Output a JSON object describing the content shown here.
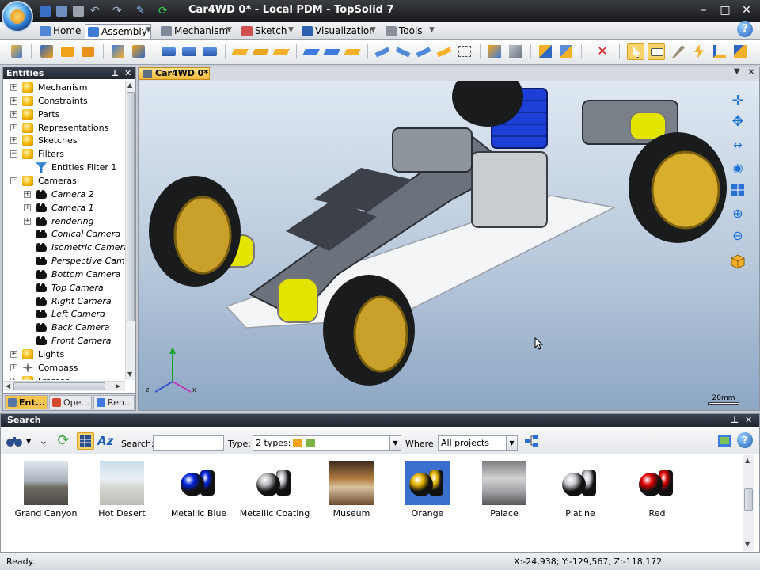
{
  "window": {
    "title": "Car4WD 0* - Local PDM - TopSolid 7",
    "minimize": "–",
    "maximize": "□",
    "close": "✕"
  },
  "ribbon": {
    "tabs": [
      {
        "label": "Home",
        "icon": "home-icon",
        "active": false
      },
      {
        "label": "Assembly",
        "icon": "assembly-icon",
        "active": true
      },
      {
        "label": "Mechanism",
        "icon": "mechanism-icon",
        "active": false
      },
      {
        "label": "Sketch",
        "icon": "sketch-icon",
        "active": false
      },
      {
        "label": "Visualization",
        "icon": "visualization-icon",
        "active": false
      },
      {
        "label": "Tools",
        "icon": "tools-icon",
        "active": false
      }
    ],
    "help": "?"
  },
  "entities": {
    "header": "Entities",
    "pin": "⊥",
    "close": "✕",
    "tree": [
      {
        "label": "Mechanism",
        "level": 0,
        "expander": "+",
        "icon": "cube-icon",
        "italic": false
      },
      {
        "label": "Constraints",
        "level": 0,
        "expander": "+",
        "icon": "cube-icon",
        "italic": false
      },
      {
        "label": "Parts",
        "level": 0,
        "expander": "+",
        "icon": "cube-icon",
        "italic": false
      },
      {
        "label": "Representations",
        "level": 0,
        "expander": "+",
        "icon": "cube-icon",
        "italic": false
      },
      {
        "label": "Sketches",
        "level": 0,
        "expander": "+",
        "icon": "cube-icon",
        "italic": false
      },
      {
        "label": "Filters",
        "level": 0,
        "expander": "−",
        "icon": "cube-icon",
        "italic": false
      },
      {
        "label": "Entities Filter 1",
        "level": 1,
        "expander": "",
        "icon": "filter-icon",
        "italic": false
      },
      {
        "label": "Cameras",
        "level": 0,
        "expander": "−",
        "icon": "cube-icon",
        "italic": false
      },
      {
        "label": "Camera 2",
        "level": 1,
        "expander": "+",
        "icon": "camera-icon",
        "italic": true
      },
      {
        "label": "Camera 1",
        "level": 1,
        "expander": "+",
        "icon": "camera-icon",
        "italic": true
      },
      {
        "label": "rendering",
        "level": 1,
        "expander": "+",
        "icon": "camera-icon",
        "italic": true
      },
      {
        "label": "Conical Camera",
        "level": 1,
        "expander": "",
        "icon": "camera-icon",
        "italic": true
      },
      {
        "label": "Isometric Camera",
        "level": 1,
        "expander": "",
        "icon": "camera-icon",
        "italic": true
      },
      {
        "label": "Perspective Camera",
        "level": 1,
        "expander": "",
        "icon": "camera-icon",
        "italic": true
      },
      {
        "label": "Bottom Camera",
        "level": 1,
        "expander": "",
        "icon": "camera-icon",
        "italic": true
      },
      {
        "label": "Top Camera",
        "level": 1,
        "expander": "",
        "icon": "camera-icon",
        "italic": true
      },
      {
        "label": "Right Camera",
        "level": 1,
        "expander": "",
        "icon": "camera-icon",
        "italic": true
      },
      {
        "label": "Left Camera",
        "level": 1,
        "expander": "",
        "icon": "camera-icon",
        "italic": true
      },
      {
        "label": "Back Camera",
        "level": 1,
        "expander": "",
        "icon": "camera-icon",
        "italic": true
      },
      {
        "label": "Front Camera",
        "level": 1,
        "expander": "",
        "icon": "camera-icon",
        "italic": true
      },
      {
        "label": "Lights",
        "level": 0,
        "expander": "+",
        "icon": "cube-icon",
        "italic": false
      },
      {
        "label": "Compass",
        "level": 0,
        "expander": "+",
        "icon": "compass-icon",
        "italic": false
      },
      {
        "label": "Frames",
        "level": 0,
        "expander": "+",
        "icon": "cube-icon",
        "italic": false
      }
    ],
    "panel_tabs": [
      {
        "label": "Ent...",
        "active": true
      },
      {
        "label": "Ope...",
        "active": false
      },
      {
        "label": "Ren...",
        "active": false
      }
    ]
  },
  "document": {
    "tab_label": "Car4WD 0*",
    "menu": "▼",
    "close": "✕",
    "scale_label": "20mm",
    "axis_labels": {
      "z": "z",
      "x": "x"
    }
  },
  "search": {
    "header": "Search",
    "search_label": "Search:",
    "search_value": "",
    "type_label": "Type:",
    "type_value": "2 types:",
    "where_label": "Where:",
    "where_value": "All projects",
    "results": [
      {
        "label": "Grand Canyon",
        "kind": "scene"
      },
      {
        "label": "Hot Desert",
        "kind": "scene"
      },
      {
        "label": "Metallic Blue",
        "kind": "material",
        "color": "#0022dd"
      },
      {
        "label": "Metallic Coating",
        "kind": "material",
        "color": "#b9bcc0"
      },
      {
        "label": "Museum",
        "kind": "scene"
      },
      {
        "label": "Orange",
        "kind": "material",
        "color": "#e6b800"
      },
      {
        "label": "Palace",
        "kind": "scene"
      },
      {
        "label": "Platine",
        "kind": "material",
        "color": "#c8cbd0"
      },
      {
        "label": "Red",
        "kind": "material",
        "color": "#e00000"
      }
    ]
  },
  "status": {
    "text": "Ready.",
    "coordinates": "X:-24,938; Y:-129,567; Z:-118,172"
  },
  "colors": {
    "accent": "#f3b93a",
    "panel_header": "#1f2630",
    "viewport_top": "#dfe8f2",
    "viewport_bottom": "#8da7c4"
  }
}
